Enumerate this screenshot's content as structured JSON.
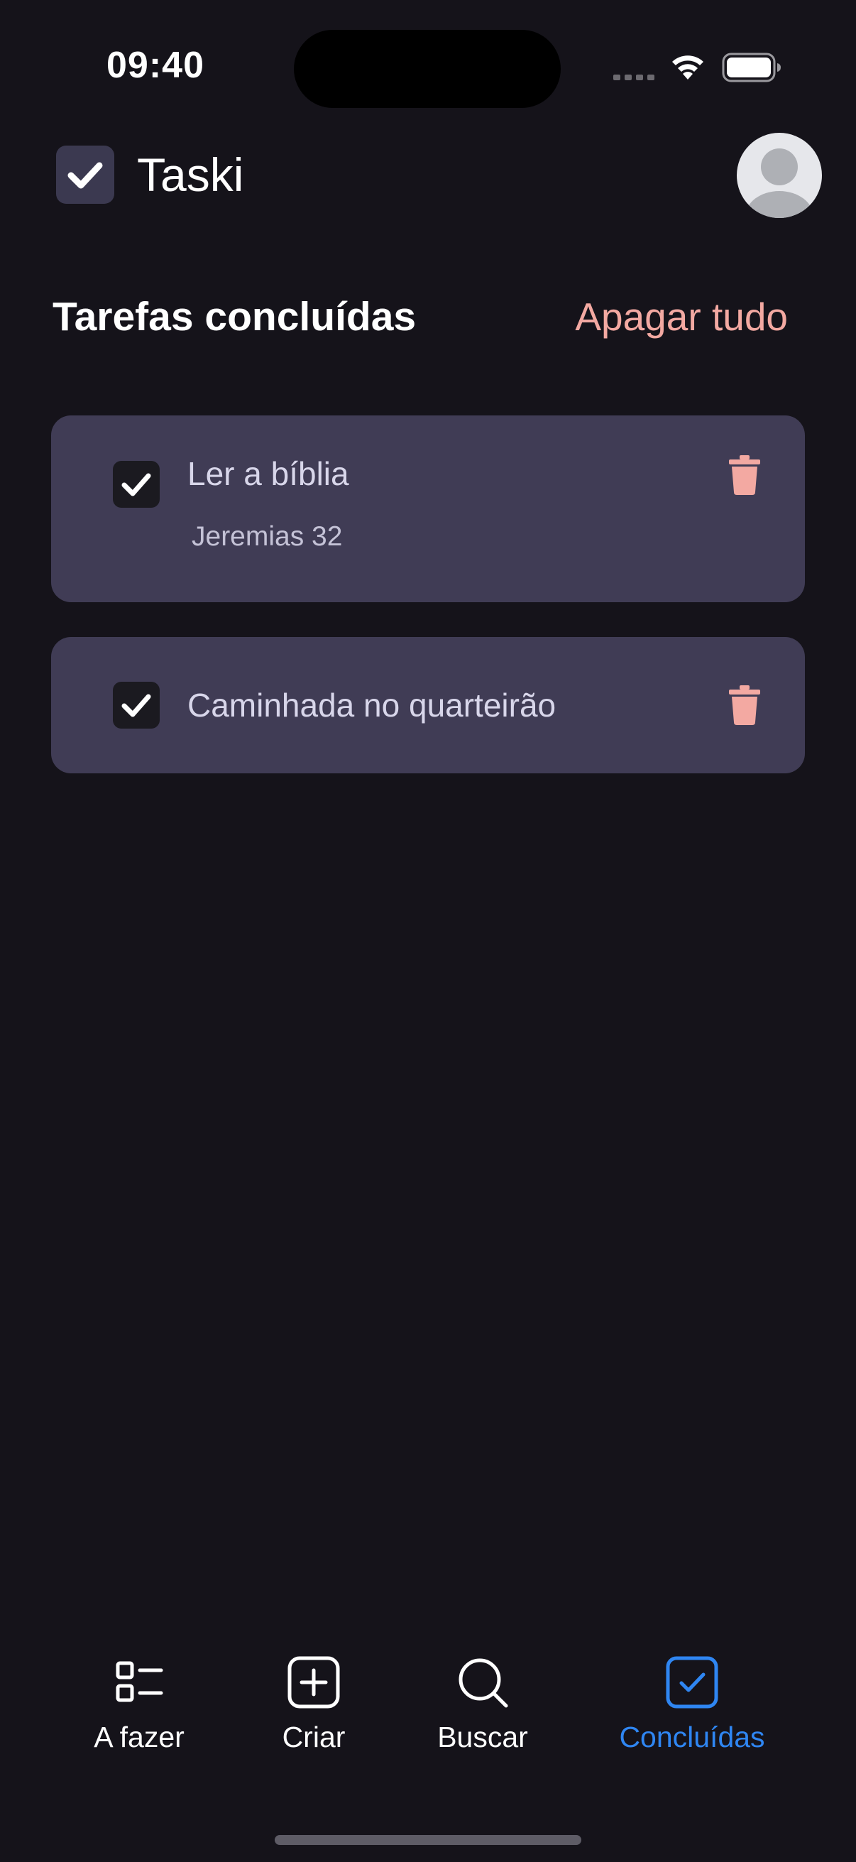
{
  "status_bar": {
    "time": "09:40"
  },
  "header": {
    "app_name": "Taski",
    "logo_icon": "check-square-icon",
    "avatar_icon": "user-avatar"
  },
  "section": {
    "title": "Tarefas concluídas",
    "clear_all_label": "Apagar tudo"
  },
  "tasks": [
    {
      "title": "Ler a bíblia",
      "description": "Jeremias 32",
      "done": true
    },
    {
      "title": "Caminhada no quarteirão",
      "description": "",
      "done": true
    }
  ],
  "nav": [
    {
      "label": "A fazer",
      "icon": "list-icon",
      "active": false
    },
    {
      "label": "Criar",
      "icon": "plus-square-icon",
      "active": false
    },
    {
      "label": "Buscar",
      "icon": "search-icon",
      "active": false
    },
    {
      "label": "Concluídas",
      "icon": "check-square-icon",
      "active": true
    }
  ],
  "colors": {
    "background": "#15131A",
    "card": "#403C55",
    "accent_danger": "#F3A9A2",
    "accent_active": "#2F86F2"
  }
}
